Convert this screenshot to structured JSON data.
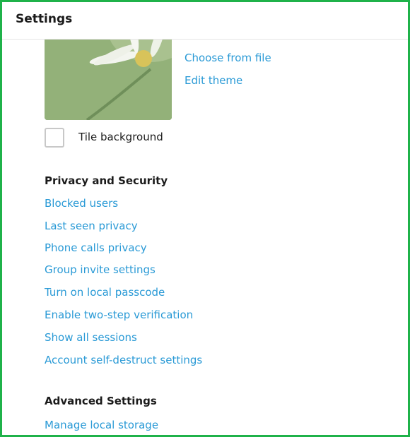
{
  "header": {
    "title": "Settings"
  },
  "background": {
    "links": [
      "Choose from file",
      "Edit theme"
    ],
    "tile_label": "Tile background",
    "tile_checked": false
  },
  "privacy": {
    "title": "Privacy and Security",
    "items": [
      "Blocked users",
      "Last seen privacy",
      "Phone calls privacy",
      "Group invite settings",
      "Turn on local passcode",
      "Enable two-step verification",
      "Show all sessions",
      "Account self-destruct settings"
    ]
  },
  "advanced": {
    "title": "Advanced Settings",
    "items": [
      "Manage local storage"
    ]
  },
  "colors": {
    "link": "#2a9ad6",
    "frame": "#1fb24a"
  }
}
